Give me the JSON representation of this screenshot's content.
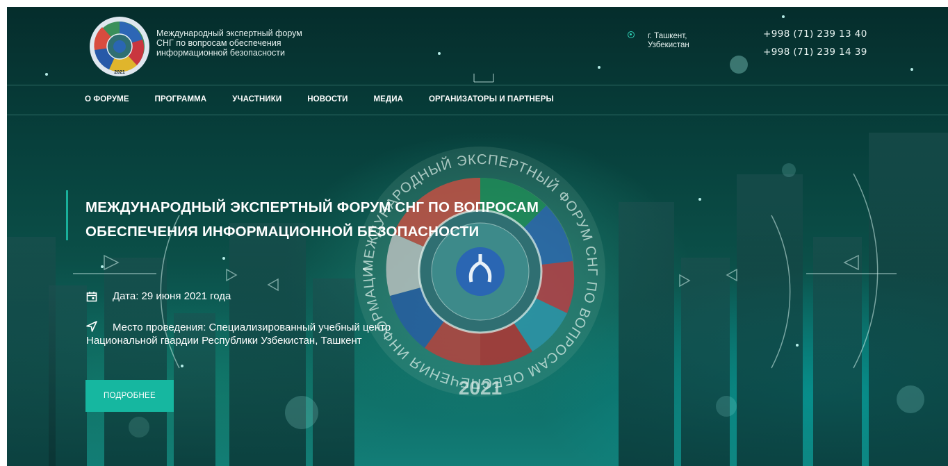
{
  "header": {
    "brand_lines": [
      "Международный экспертный форум",
      "СНГ по вопросам обеспечения",
      "информационной безопасности"
    ],
    "location_lines": [
      "г. Ташкент,",
      "Узбекистан"
    ],
    "phones": [
      "+998 (71) 239 13 40",
      "+998 (71) 239 14 39"
    ],
    "logo_year": "2021"
  },
  "nav": {
    "items": [
      "О ФОРУМЕ",
      "ПРОГРАММА",
      "УЧАСТНИКИ",
      "НОВОСТИ",
      "МЕДИА",
      "ОРГАНИЗАТОРЫ И ПАРТНЕРЫ"
    ]
  },
  "hero": {
    "title_lines": [
      "МЕЖДУНАРОДНЫЙ ЭКСПЕРТНЫЙ ФОРУМ СНГ ПО ВОПРОСАМ",
      "ОБЕСПЕЧЕНИЯ ИНФОРМАЦИОННОЙ БЕЗОПАСНОСТИ"
    ],
    "date_text": "Дата: 29 июня 2021 года",
    "place_lines": [
      "Место проведения: Специализированный учебный центр",
      "Национальной гвардии Республики Узбекистан, Ташкент"
    ],
    "cta_label": "ПОДРОБНЕЕ",
    "emblem_ring_text": "МЕЖДУНАРОДНЫЙ ЭКСПЕРТНЫЙ ФОРУМ СНГ ПО ВОПРОСАМ ОБЕСПЕЧЕНИЯ ИНФОРМАЦИОННОЙ БЕЗОПАСНОСТИ",
    "emblem_year": "2021"
  },
  "icons": {
    "location": "location-dot-icon",
    "calendar": "calendar-icon",
    "place": "navigation-arrow-icon"
  },
  "colors": {
    "accent": "#16b7a0",
    "background": "#0b4f48"
  }
}
